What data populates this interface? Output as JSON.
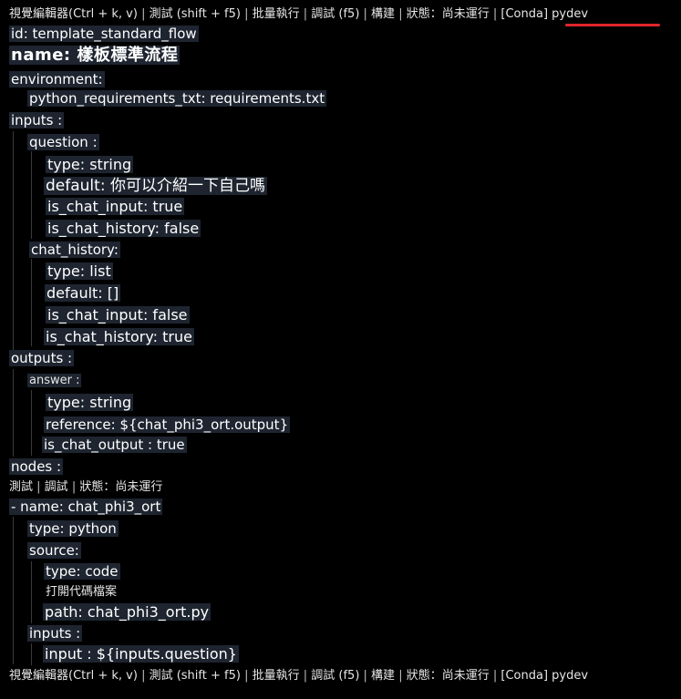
{
  "codelens_top": {
    "visual_editor": "視覺編輯器(Ctrl + k, v)",
    "test": "測試 (shift + f5)",
    "batch_run": "批量執行",
    "debug": "調試 (f5)",
    "build": "構建",
    "status": "狀態：尚未運行",
    "env": "[Conda] pydev"
  },
  "codelens_bottom": {
    "visual_editor": "視覺編輯器(Ctrl + k, v)",
    "test": "測試 (shift + f5)",
    "batch_run": "批量執行",
    "debug": "調試 (f5)",
    "build": "構建",
    "status": "狀態：尚未運行",
    "env": "[Conda] pydev"
  },
  "node_codelens": {
    "test": "測試",
    "debug": "調試",
    "status": "狀態：尚未運行"
  },
  "open_code_file": "打開代碼檔案",
  "yaml": {
    "id": "id: template_standard_flow",
    "name": "name: 樣板標準流程",
    "environment": "environment:",
    "python_requirements": "python_requirements_txt: requirements.txt",
    "inputs": "inputs :",
    "question": "question :",
    "q_type": "type: string",
    "q_default": "default: 你可以介紹一下自己嗎",
    "q_is_chat_input": "is_chat_input: true",
    "q_is_chat_history": "is_chat_history: false",
    "chat_history": "chat_history:",
    "ch_type": "type: list",
    "ch_default": "default: []",
    "ch_is_chat_input": "is_chat_input: false",
    "ch_is_chat_history": "is_chat_history: true",
    "outputs": "outputs :",
    "answer": "answer :",
    "a_type": "type: string",
    "a_reference": "reference: ${chat_phi3_ort.output}",
    "a_is_chat_output": "is_chat_output : true",
    "nodes": "nodes :",
    "node_name": "- name: chat_phi3_ort",
    "node_type": "type: python",
    "source": "source:",
    "src_type": "type: code",
    "src_path": "path: chat_phi3_ort.py",
    "node_inputs": "inputs :",
    "node_input": "input : ${inputs.question}"
  },
  "colors": {
    "background": "#000000",
    "highlight": "#1e2530",
    "text": "#ffffff",
    "annotation": "#e0262a"
  }
}
